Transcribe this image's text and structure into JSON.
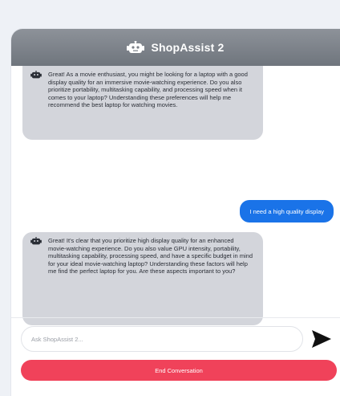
{
  "header": {
    "title": "ShopAssist 2",
    "icon": "robot-icon"
  },
  "messages": [
    {
      "sender": "bot",
      "text": "Great! As a movie enthusiast, you might be looking for a laptop with a good display quality for an immersive movie-watching experience. Do you also prioritize portability, multitasking capability, and processing speed when it comes to your laptop? Understanding these preferences will help me recommend the best laptop for watching movies."
    },
    {
      "sender": "user",
      "text": "I need a high quality display"
    },
    {
      "sender": "bot",
      "text": "Great! It's clear that you prioritize high display quality for an enhanced movie-watching experience. Do you also value GPU intensity, portability, multitasking capability, processing speed, and have a specific budget in mind for your ideal movie-watching laptop? Understanding these factors will help me find the perfect laptop for you. Are these aspects important to you?"
    }
  ],
  "composer": {
    "placeholder": "Ask ShopAssist 2...",
    "value": "",
    "send_icon": "send-arrow-icon"
  },
  "actions": {
    "end_label": "End Conversation"
  },
  "colors": {
    "header": "#7a7f87",
    "bot_bubble": "#d3d5db",
    "user_bubble": "#1a73e8",
    "end_button": "#f0425a"
  }
}
